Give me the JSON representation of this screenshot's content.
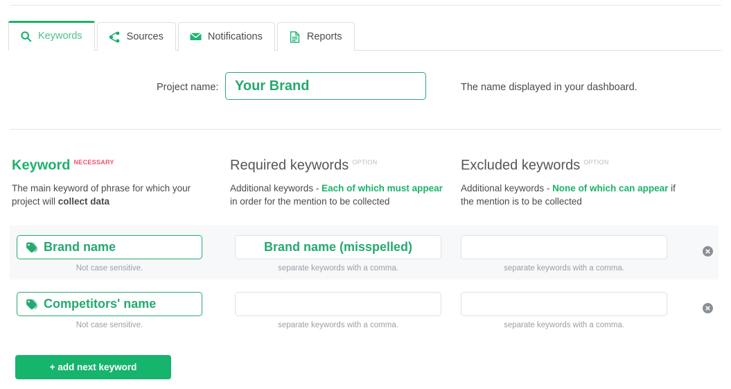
{
  "tabs": [
    {
      "label": "Keywords",
      "icon": "search-icon",
      "active": true
    },
    {
      "label": "Sources",
      "icon": "share-nodes-icon",
      "active": false
    },
    {
      "label": "Notifications",
      "icon": "envelope-icon",
      "active": false
    },
    {
      "label": "Reports",
      "icon": "document-icon",
      "active": false
    }
  ],
  "project": {
    "label": "Project name:",
    "value": "Your Brand",
    "placeholder": "Your Brand",
    "hint": "The name displayed in your dashboard."
  },
  "columns": [
    {
      "title": "Keyword",
      "flag": "NECESSARY",
      "flag_type": "necessary",
      "desc_pre": "The main keyword of phrase for which your project will ",
      "desc_bold": "collect data",
      "desc_post": ""
    },
    {
      "title": "Required keywords",
      "flag": "OPTION",
      "flag_type": "option",
      "desc_pre": "Additional keywords - ",
      "desc_em": "Each of which must appear",
      "desc_post": " in order for the mention to be collected"
    },
    {
      "title": "Excluded keywords",
      "flag": "OPTION",
      "flag_type": "option",
      "desc_pre": "Additional keywords - ",
      "desc_em": "None of which can appear",
      "desc_post": " if the mention is to be collected"
    }
  ],
  "hints": {
    "case": "Not case sensitive.",
    "comma": "separate keywords with a comma."
  },
  "rows": [
    {
      "keyword": "Brand name",
      "required": "Brand name (misspelled)",
      "excluded": "",
      "shaded": true
    },
    {
      "keyword": "Competitors' name",
      "required": "",
      "excluded": "",
      "shaded": false
    }
  ],
  "add_button": {
    "label": "+ add next keyword"
  },
  "colors": {
    "green": "#1cb26b",
    "green_text": "#25a96f",
    "red": "#f0526d",
    "muted": "#9aa0a6",
    "row_shade": "#f7f8fa"
  }
}
